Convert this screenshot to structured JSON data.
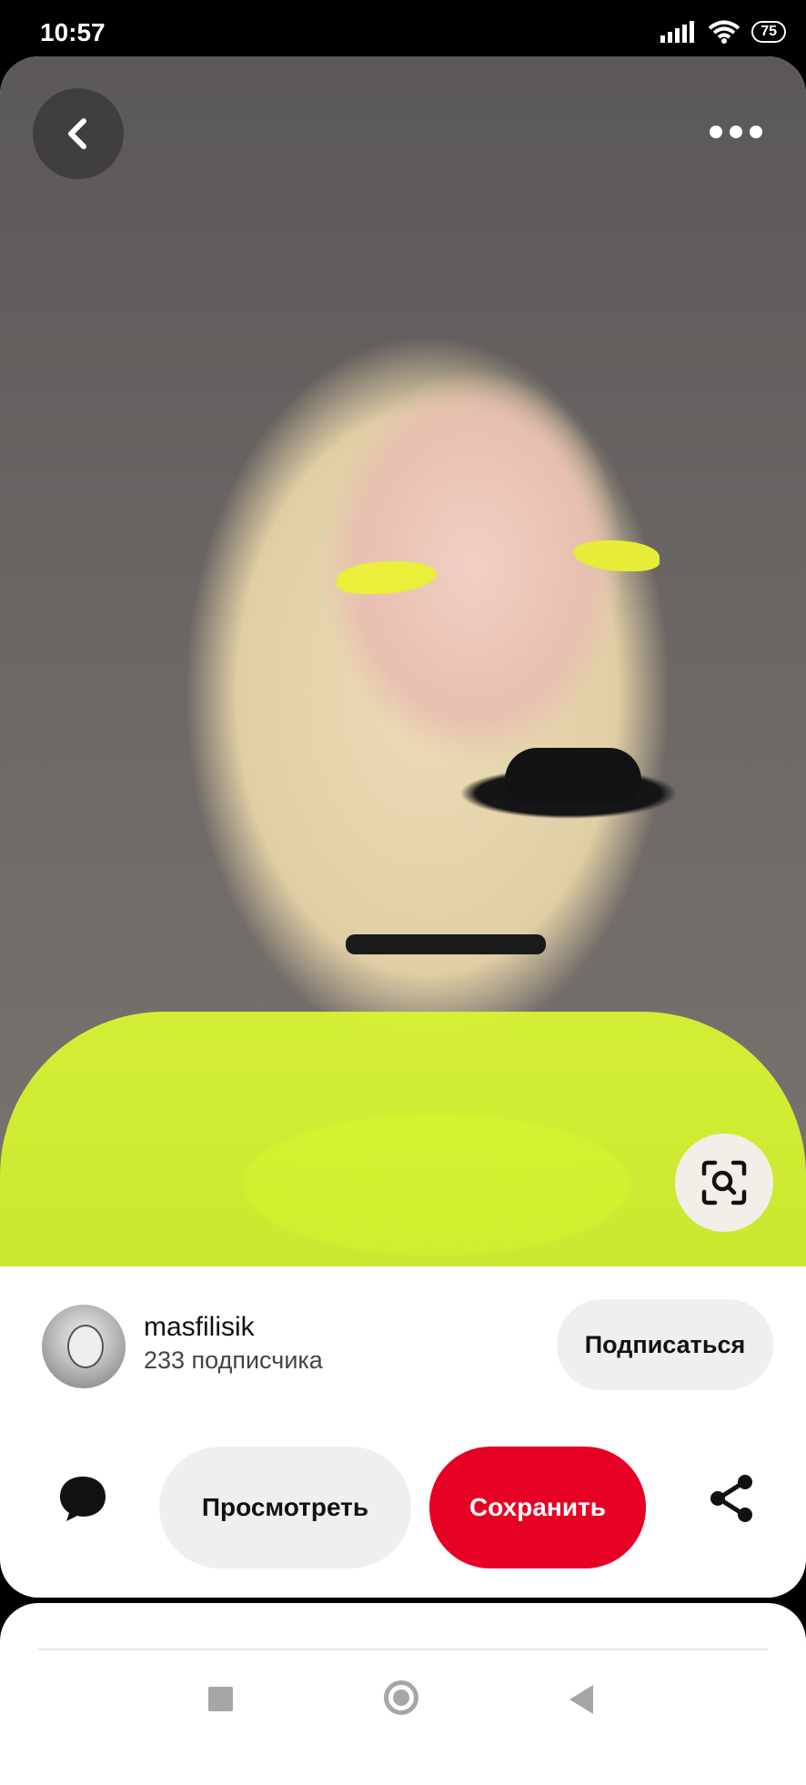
{
  "status_bar": {
    "time": "10:57",
    "battery": "75"
  },
  "pin": {
    "image_description_icon": "photo",
    "back_icon": "chevron-left-icon",
    "more_icon": "more-horizontal-icon",
    "visual_search_icon": "visual-search-icon"
  },
  "creator": {
    "name": "masfilisik",
    "followers": "233 подписчика",
    "follow_label": "Подписаться"
  },
  "actions": {
    "view_label": "Просмотреть",
    "save_label": "Сохранить",
    "comment_icon": "comment-icon",
    "share_icon": "share-icon"
  },
  "colors": {
    "save_red": "#e60023",
    "pill_gray": "#efefef"
  }
}
